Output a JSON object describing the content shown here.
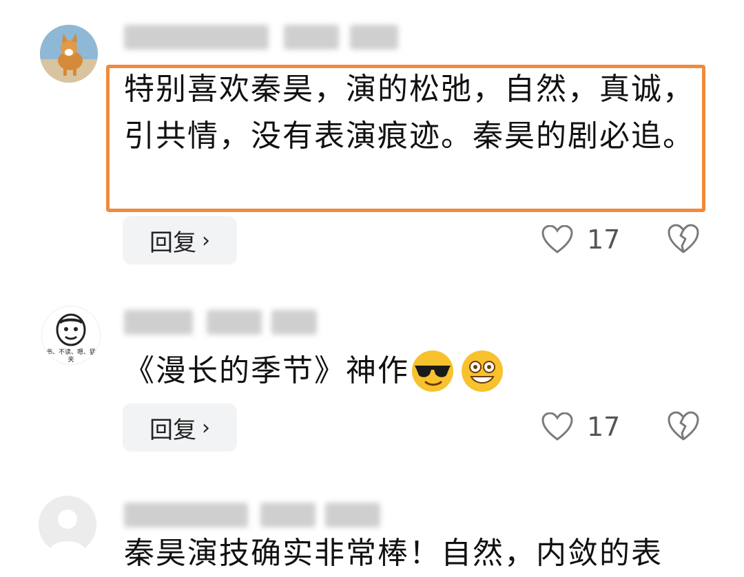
{
  "comments": [
    {
      "text": "特别喜欢秦昊，演的松弛，自然，真诚，引共情，没有表演痕迹。秦昊的剧必追。",
      "reply_label": "回复",
      "likes": "17",
      "avatar_icon": "corgi-avatar-icon"
    },
    {
      "text": "《漫长的季节》神作",
      "reply_label": "回复",
      "likes": "17",
      "avatar_icon": "meme-face-avatar-icon",
      "avatar_caption": "书、不读、嗯、猛夹",
      "emojis": [
        "sunglasses-emoji-icon",
        "grinning-emoji-icon"
      ]
    },
    {
      "text": "秦昊演技确实非常棒！自然，内敛的表",
      "avatar_icon": "default-avatar-icon"
    }
  ],
  "colors": {
    "highlight_border": "#f08a3c",
    "reply_bg": "#f2f3f5",
    "icon_gray": "#7a7a7a"
  }
}
